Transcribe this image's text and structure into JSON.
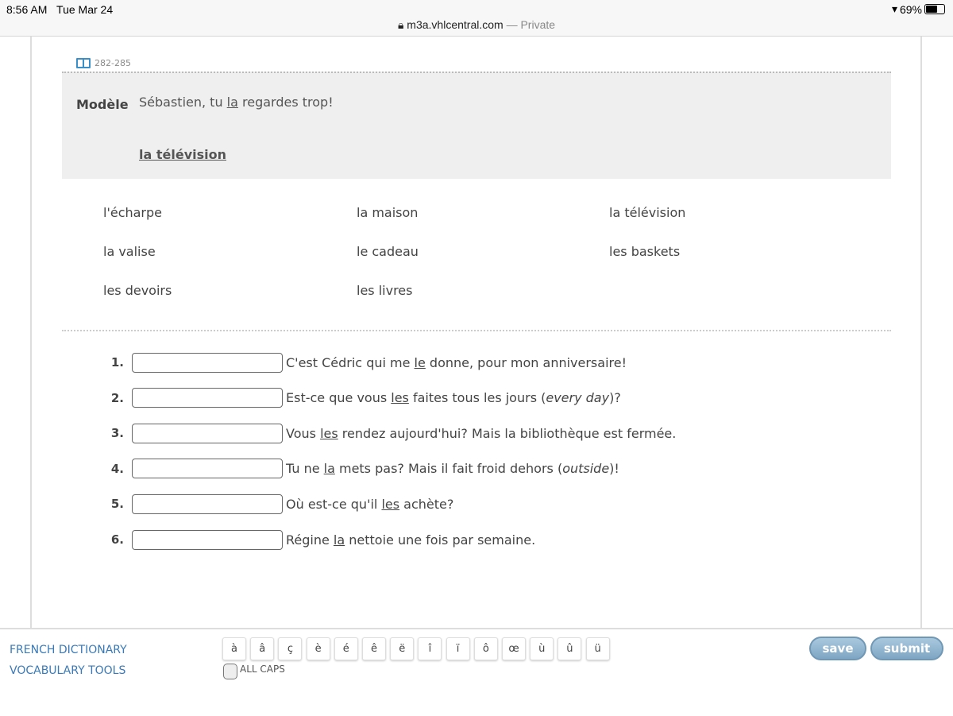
{
  "status_bar": {
    "time": "8:56 AM",
    "date": "Tue Mar 24",
    "battery": "69%",
    "url": "m3a.vhlcentral.com",
    "private": "— Private"
  },
  "pages": "282-285",
  "model": {
    "label": "Modèle",
    "sentence": [
      {
        "t": "Sébastien, tu "
      },
      {
        "t": "la",
        "u": true
      },
      {
        "t": " regardes trop!"
      }
    ],
    "answer": "la télévision"
  },
  "word_bank": [
    [
      "l'écharpe",
      "la maison",
      "la télévision"
    ],
    [
      "la valise",
      "le cadeau",
      "les baskets"
    ],
    [
      "les devoirs",
      "les livres"
    ]
  ],
  "items": [
    {
      "num": "1.",
      "value": "",
      "parts": [
        {
          "t": "C'est Cédric qui me "
        },
        {
          "t": "le",
          "u": true
        },
        {
          "t": " donne, pour mon anniversaire!"
        }
      ]
    },
    {
      "num": "2.",
      "value": "",
      "parts": [
        {
          "t": "Est-ce que vous "
        },
        {
          "t": "les",
          "u": true
        },
        {
          "t": " faites tous les jours ("
        },
        {
          "t": "every day",
          "i": true
        },
        {
          "t": ")?"
        }
      ]
    },
    {
      "num": "3.",
      "value": "",
      "parts": [
        {
          "t": "Vous "
        },
        {
          "t": "les",
          "u": true
        },
        {
          "t": " rendez aujourd'hui? Mais la bibliothèque est fermée."
        }
      ]
    },
    {
      "num": "4.",
      "value": "",
      "parts": [
        {
          "t": "Tu ne "
        },
        {
          "t": "la",
          "u": true
        },
        {
          "t": " mets pas? Mais il fait froid dehors ("
        },
        {
          "t": "outside",
          "i": true
        },
        {
          "t": ")!"
        }
      ]
    },
    {
      "num": "5.",
      "value": "",
      "parts": [
        {
          "t": "Où est-ce qu'il "
        },
        {
          "t": "les",
          "u": true
        },
        {
          "t": " achète?"
        }
      ]
    },
    {
      "num": "6.",
      "value": "",
      "parts": [
        {
          "t": "Régine "
        },
        {
          "t": "la",
          "u": true
        },
        {
          "t": " nettoie une fois par semaine."
        }
      ]
    }
  ],
  "footer": {
    "dictionary": "FRENCH DICTIONARY",
    "vocab": "VOCABULARY TOOLS",
    "all_caps": "ALL CAPS",
    "save": "save",
    "submit": "submit",
    "accents": [
      "à",
      "â",
      "ç",
      "è",
      "é",
      "ê",
      "ë",
      "î",
      "ï",
      "ô",
      "œ",
      "ù",
      "û",
      "ü"
    ]
  }
}
